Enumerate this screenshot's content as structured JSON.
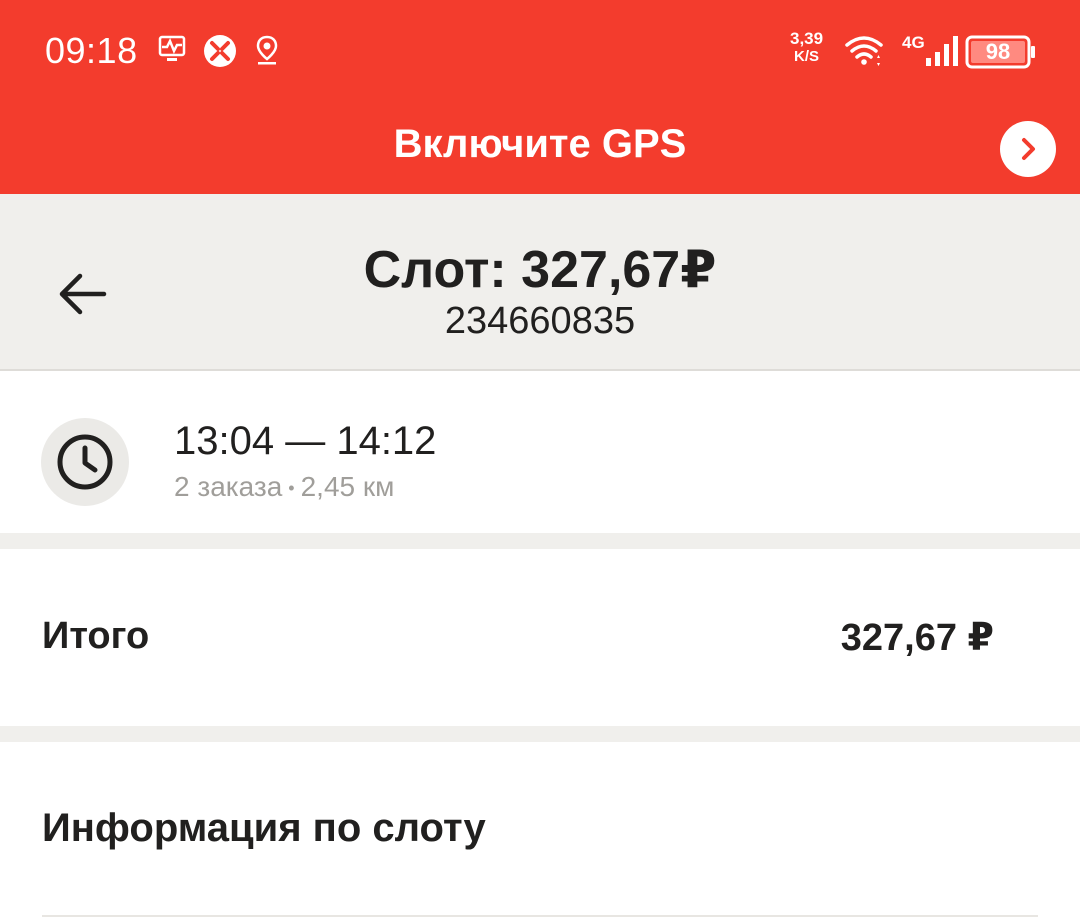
{
  "status_bar": {
    "time": "09:18",
    "net_speed_value": "3,39",
    "net_speed_unit": "K/S",
    "network_type": "4G",
    "battery": "98",
    "icons": [
      "activity-icon",
      "app-notification-icon",
      "location-icon",
      "wifi-icon",
      "signal-icon",
      "battery-icon"
    ]
  },
  "gps_banner": {
    "text": "Включите GPS",
    "arrow_icon": "chevron-right-icon"
  },
  "header": {
    "title": "Слот: 327,67₽",
    "subtitle": "234660835",
    "back_icon": "arrow-left-icon"
  },
  "slot_time": {
    "range": "13:04 — 14:12",
    "orders": "2 заказа",
    "distance": "2,45 км",
    "icon": "clock-icon"
  },
  "total": {
    "label": "Итого",
    "value": "327,67 ₽"
  },
  "info": {
    "title": "Информация по слоту"
  },
  "colors": {
    "banner_red": "#f33c2d",
    "header_gray": "#f0efec",
    "text_dark": "#21201f",
    "text_muted": "#a09e9a"
  }
}
